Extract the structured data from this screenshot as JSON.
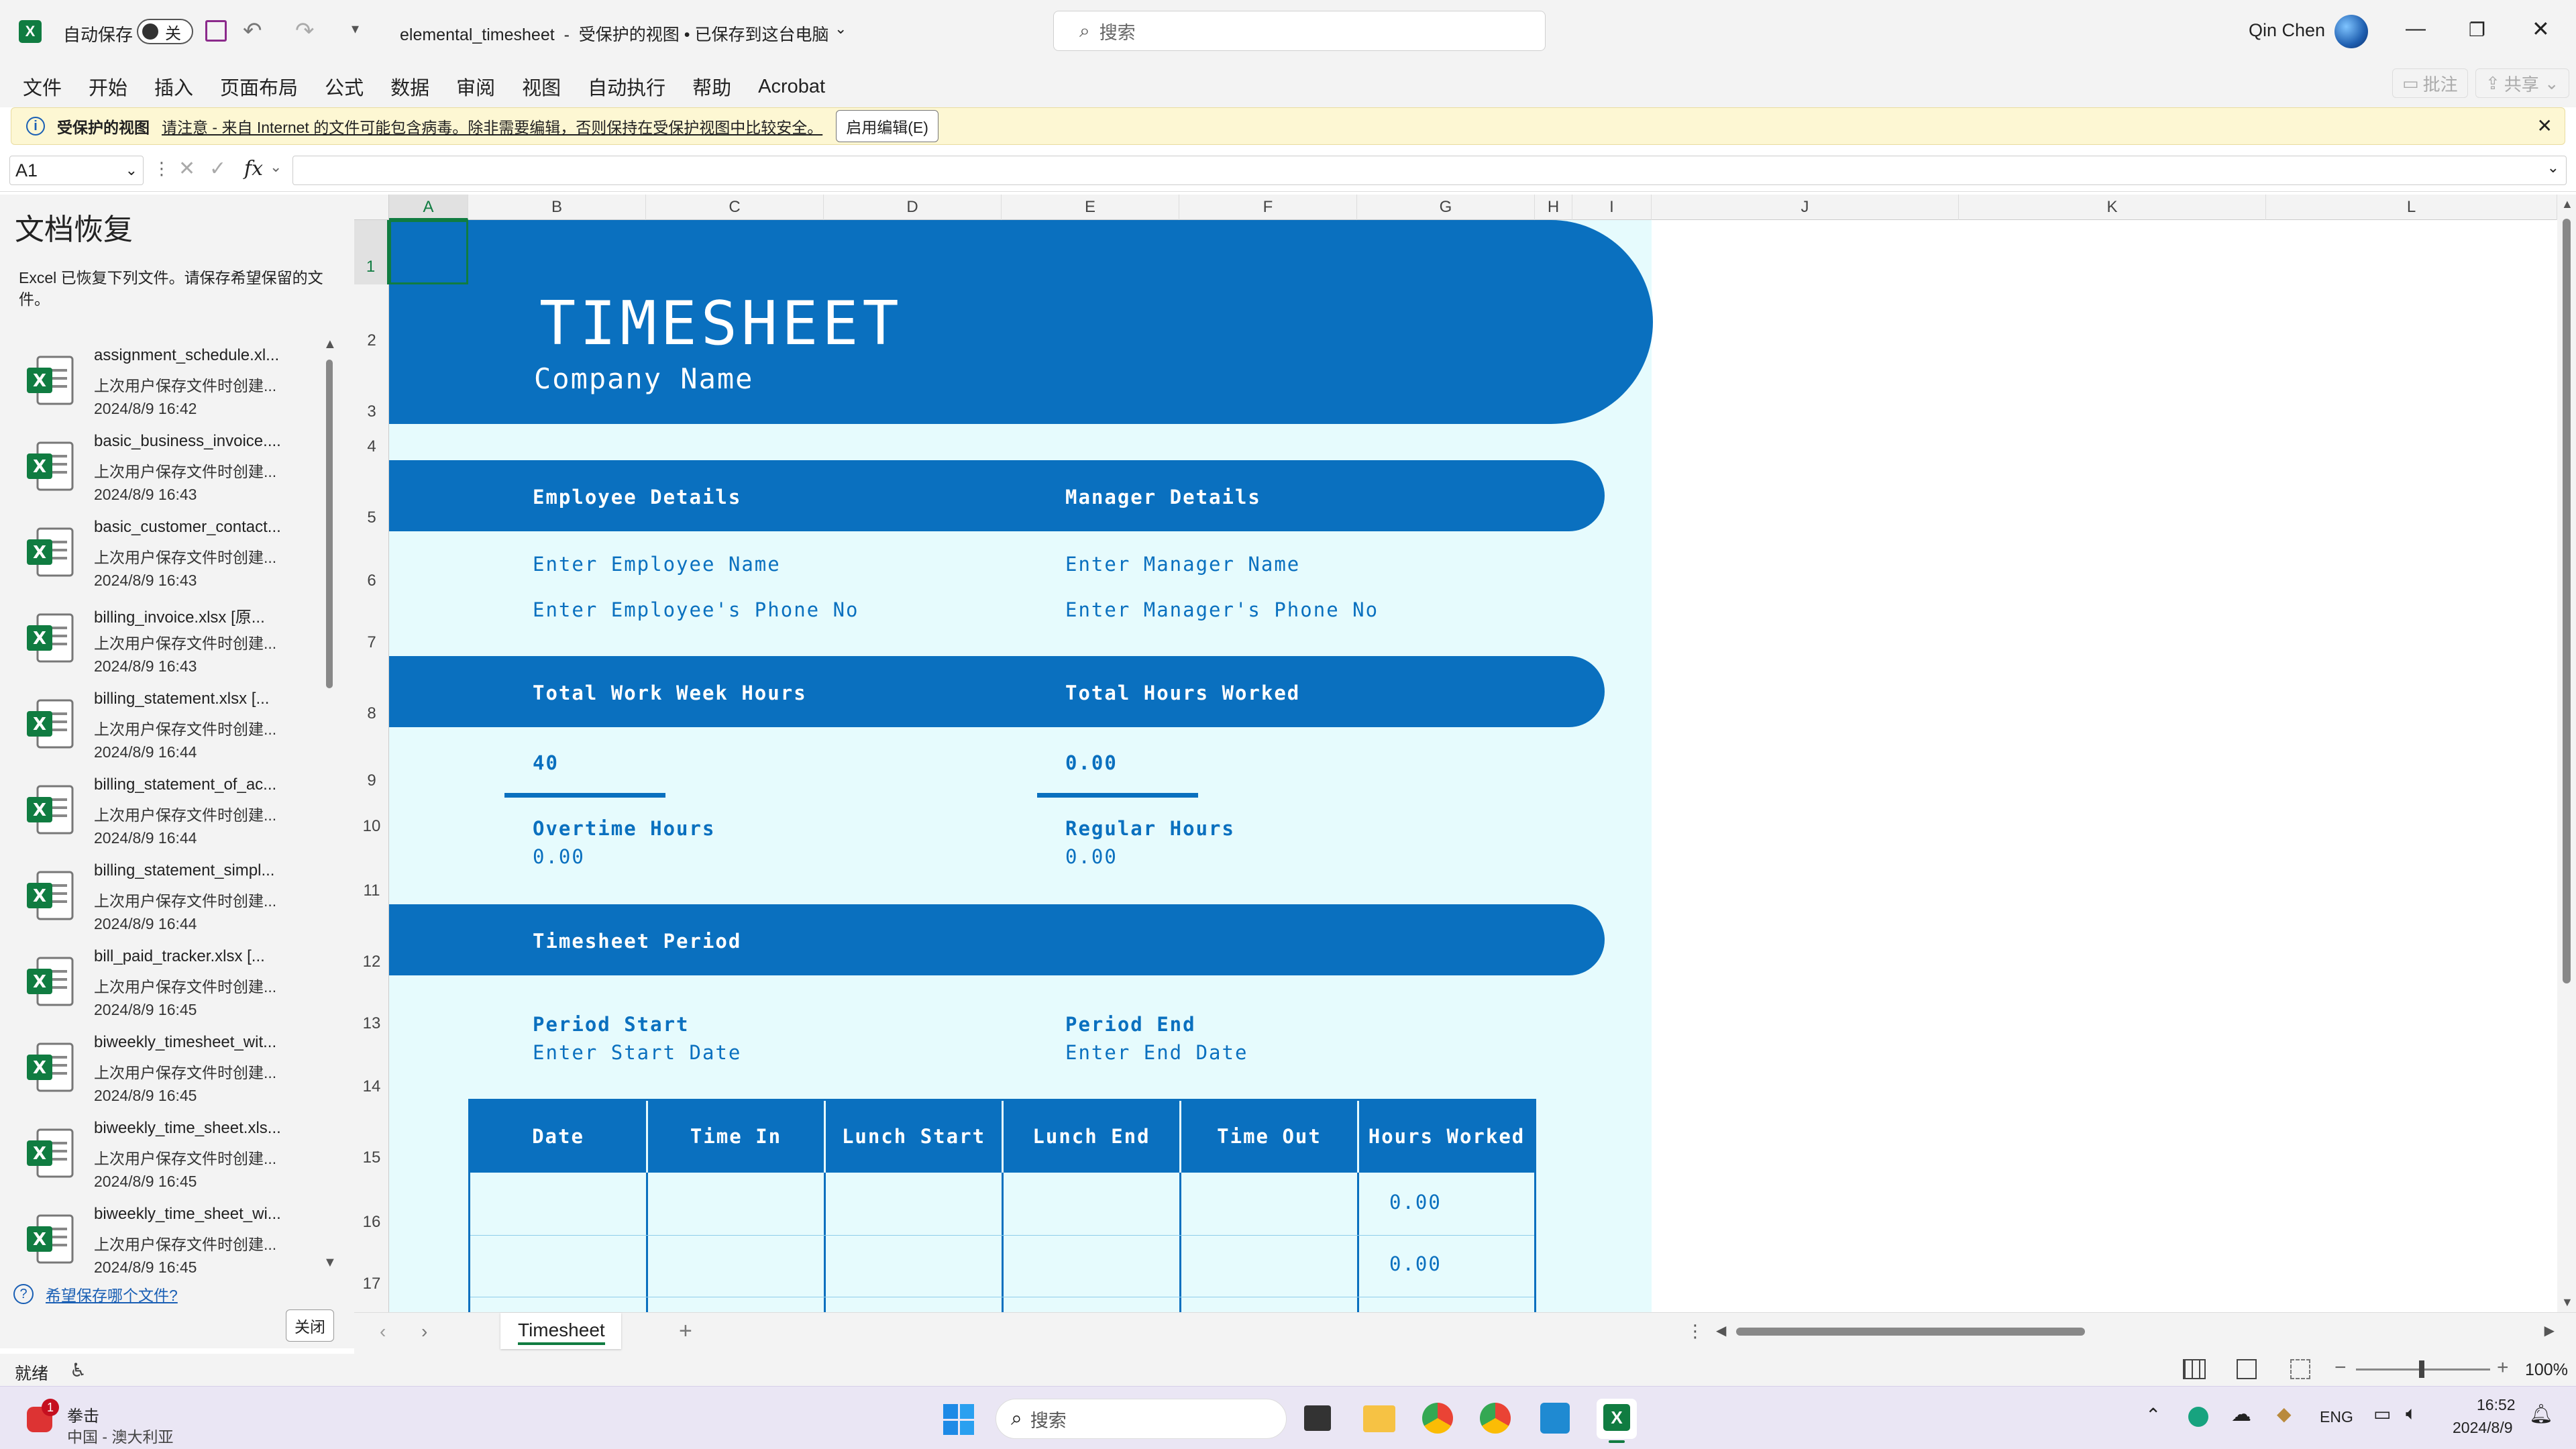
{
  "titlebar": {
    "autosave_label": "自动保存",
    "autosave_state": "关",
    "doc_title": "elemental_timesheet  -  受保护的视图 • 已保存到这台电脑",
    "search_placeholder": "搜索",
    "user_name": "Qin Chen"
  },
  "ribbon": {
    "menus": [
      "文件",
      "开始",
      "插入",
      "页面布局",
      "公式",
      "数据",
      "审阅",
      "视图",
      "自动执行",
      "帮助",
      "Acrobat"
    ],
    "comments_label": "批注",
    "share_label": "共享"
  },
  "protected_bar": {
    "title": "受保护的视图",
    "message": "请注意 - 来自 Internet 的文件可能包含病毒。除非需要编辑，否则保持在受保护视图中比较安全。",
    "enable_button": "启用编辑(E)"
  },
  "formula_bar": {
    "name_box": "A1",
    "fx": "fx",
    "value": ""
  },
  "recovery": {
    "title": "文档恢复",
    "description": "Excel 已恢复下列文件。请保存希望保留的文件。",
    "items": [
      {
        "name": "assignment_schedule.xl...",
        "desc": "上次用户保存文件时创建...",
        "date": "2024/8/9 16:42"
      },
      {
        "name": "basic_business_invoice....",
        "desc": "上次用户保存文件时创建...",
        "date": "2024/8/9 16:43"
      },
      {
        "name": "basic_customer_contact...",
        "desc": "上次用户保存文件时创建...",
        "date": "2024/8/9 16:43"
      },
      {
        "name": "billing_invoice.xlsx  [原...",
        "desc": "上次用户保存文件时创建...",
        "date": "2024/8/9 16:43"
      },
      {
        "name": "billing_statement.xlsx  [...",
        "desc": "上次用户保存文件时创建...",
        "date": "2024/8/9 16:44"
      },
      {
        "name": "billing_statement_of_ac...",
        "desc": "上次用户保存文件时创建...",
        "date": "2024/8/9 16:44"
      },
      {
        "name": "billing_statement_simpl...",
        "desc": "上次用户保存文件时创建...",
        "date": "2024/8/9 16:44"
      },
      {
        "name": "bill_paid_tracker.xlsx  [...",
        "desc": "上次用户保存文件时创建...",
        "date": "2024/8/9 16:45"
      },
      {
        "name": "biweekly_timesheet_wit...",
        "desc": "上次用户保存文件时创建...",
        "date": "2024/8/9 16:45"
      },
      {
        "name": "biweekly_time_sheet.xls...",
        "desc": "上次用户保存文件时创建...",
        "date": "2024/8/9 16:45"
      },
      {
        "name": "biweekly_time_sheet_wi...",
        "desc": "上次用户保存文件时创建...",
        "date": "2024/8/9 16:45"
      }
    ],
    "help_link": "希望保存哪个文件?",
    "close_button": "关闭"
  },
  "columns": [
    "A",
    "B",
    "C",
    "D",
    "E",
    "F",
    "G",
    "H",
    "I",
    "J",
    "K",
    "L"
  ],
  "rows": [
    "1",
    "2",
    "3",
    "4",
    "5",
    "6",
    "7",
    "8",
    "9",
    "10",
    "11",
    "12",
    "13",
    "14",
    "15",
    "16",
    "17"
  ],
  "sheet": {
    "title": "TIMESHEET",
    "company": "Company Name",
    "employee_details": "Employee Details",
    "manager_details": "Manager Details",
    "employee_name": "Enter Employee Name",
    "employee_phone": "Enter Employee's Phone No",
    "manager_name": "Enter Manager Name",
    "manager_phone": "Enter Manager's Phone No",
    "total_work_week_hours_label": "Total Work Week Hours",
    "total_hours_worked_label": "Total Hours Worked",
    "total_work_week_hours": "40",
    "total_hours_worked": "0.00",
    "overtime_label": "Overtime Hours",
    "overtime_value": "0.00",
    "regular_label": "Regular Hours",
    "regular_value": "0.00",
    "period_header": "Timesheet Period",
    "period_start_label": "Period Start",
    "period_start_value": "Enter Start Date",
    "period_end_label": "Period End",
    "period_end_value": "Enter End Date",
    "table_headers": [
      "Date",
      "Time In",
      "Lunch Start",
      "Lunch End",
      "Time Out",
      "Hours Worked"
    ],
    "table_rows": [
      [
        "",
        "",
        "",
        "",
        "",
        "0.00"
      ],
      [
        "",
        "",
        "",
        "",
        "",
        "0.00"
      ]
    ]
  },
  "tabs": {
    "active": "Timesheet"
  },
  "status": {
    "ready": "就绪",
    "zoom": "100%"
  },
  "taskbar": {
    "weather_title": "拳击",
    "weather_sub": "中国 - 澳大利亚",
    "weather_badge": "1",
    "search_placeholder": "搜索",
    "lang": "ENG",
    "time": "16:52",
    "date": "2024/8/9"
  },
  "colors": {
    "accent": "#0a70bf",
    "sheet_bg": "#e6fbfd",
    "excel_green": "#107c41"
  }
}
